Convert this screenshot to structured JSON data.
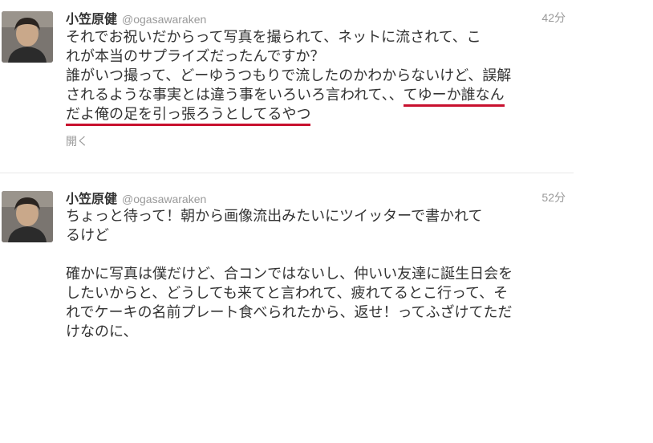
{
  "tweets": [
    {
      "fullname": "小笠原健",
      "screen_name": "@ogasawaraken",
      "time": "42分",
      "lines": [
        "それでお祝いだからって写真を撮られて、ネットに流されて、こ",
        "れが本当のサプライズだったんですか？",
        "誰がいつ撮って、どーゆうつもりで流したのかわからないけど、誤解"
      ],
      "line4_plain": "されるような事実とは違う事をいろいろ言われて、、",
      "line4_underlined": "てゆーか誰なん",
      "line5_underlined": "だよ俺の足を引っ張ろうとしてるやつ",
      "expand_label": "開く"
    },
    {
      "fullname": "小笠原健",
      "screen_name": "@ogasawaraken",
      "time": "52分",
      "lines_a": [
        "ちょっと待って！朝から画像流出みたいにツイッターで書かれて",
        "るけど"
      ],
      "lines_b": [
        "確かに写真は僕だけど、合コンではないし、仲いい友達に誕生日会を",
        "したいからと、どうしても来てと言われて、疲れてるとこ行って、そ",
        "れでケーキの名前プレート食べられたから、返せ！ってふざけてただ",
        "けなのに、"
      ]
    }
  ],
  "colors": {
    "underline": "#c8102e",
    "muted": "#999999",
    "text": "#333333"
  }
}
